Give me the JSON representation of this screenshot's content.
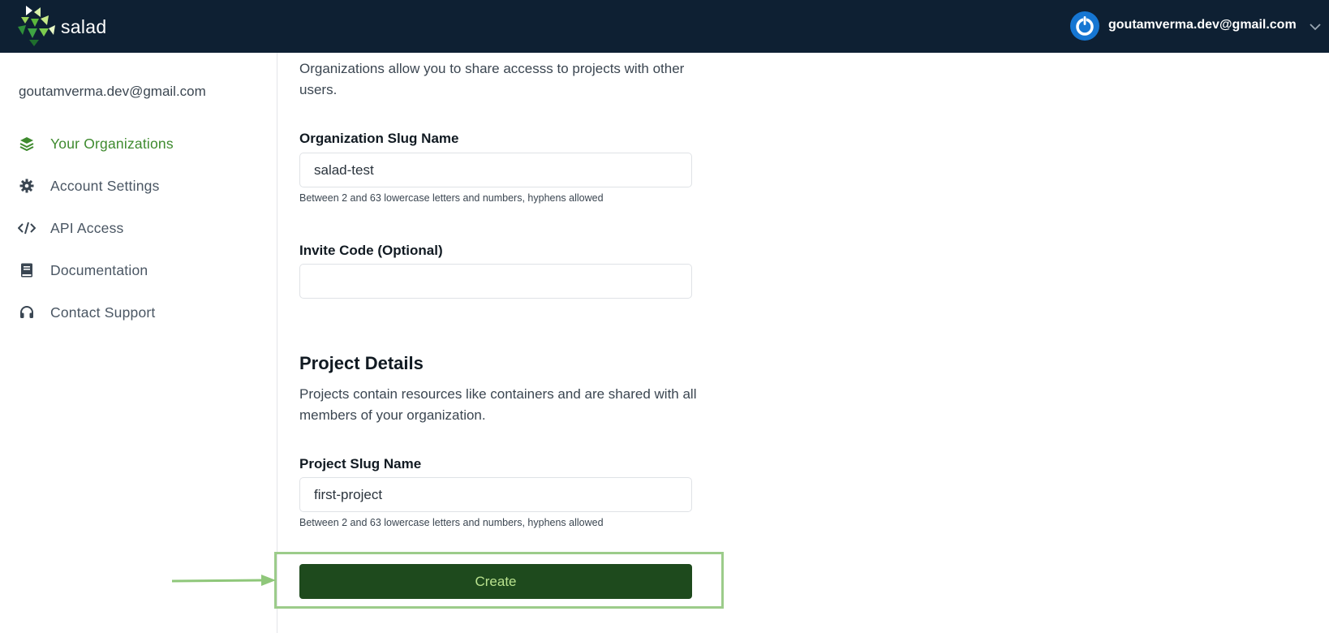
{
  "topbar": {
    "brand": "salad",
    "user_email": "goutamverma.dev@gmail.com"
  },
  "sidebar": {
    "email": "goutamverma.dev@gmail.com",
    "items": [
      {
        "label": "Your Organizations",
        "icon": "layers-icon",
        "active": true
      },
      {
        "label": "Account Settings",
        "icon": "gear-icon",
        "active": false
      },
      {
        "label": "API Access",
        "icon": "code-icon",
        "active": false
      },
      {
        "label": "Documentation",
        "icon": "book-icon",
        "active": false
      },
      {
        "label": "Contact Support",
        "icon": "headset-icon",
        "active": false
      }
    ]
  },
  "form": {
    "org_description": "Organizations allow you to share accesss to projects with other users.",
    "org_slug": {
      "label": "Organization Slug Name",
      "value": "salad-test",
      "hint": "Between 2 and 63 lowercase letters and numbers, hyphens allowed"
    },
    "invite_code": {
      "label": "Invite Code (Optional)",
      "value": ""
    },
    "project_section_title": "Project Details",
    "project_description": "Projects contain resources like containers and are shared with all members of your organization.",
    "project_slug": {
      "label": "Project Slug Name",
      "value": "first-project",
      "hint": "Between 2 and 63 lowercase letters and numbers, hyphens allowed"
    },
    "create_label": "Create"
  },
  "colors": {
    "topbar": "#0e2033",
    "active_nav": "#3e8a2e",
    "create_button_bg": "#1e4a1d",
    "create_button_text": "#b9e28e",
    "highlight": "#9ccc8a"
  }
}
